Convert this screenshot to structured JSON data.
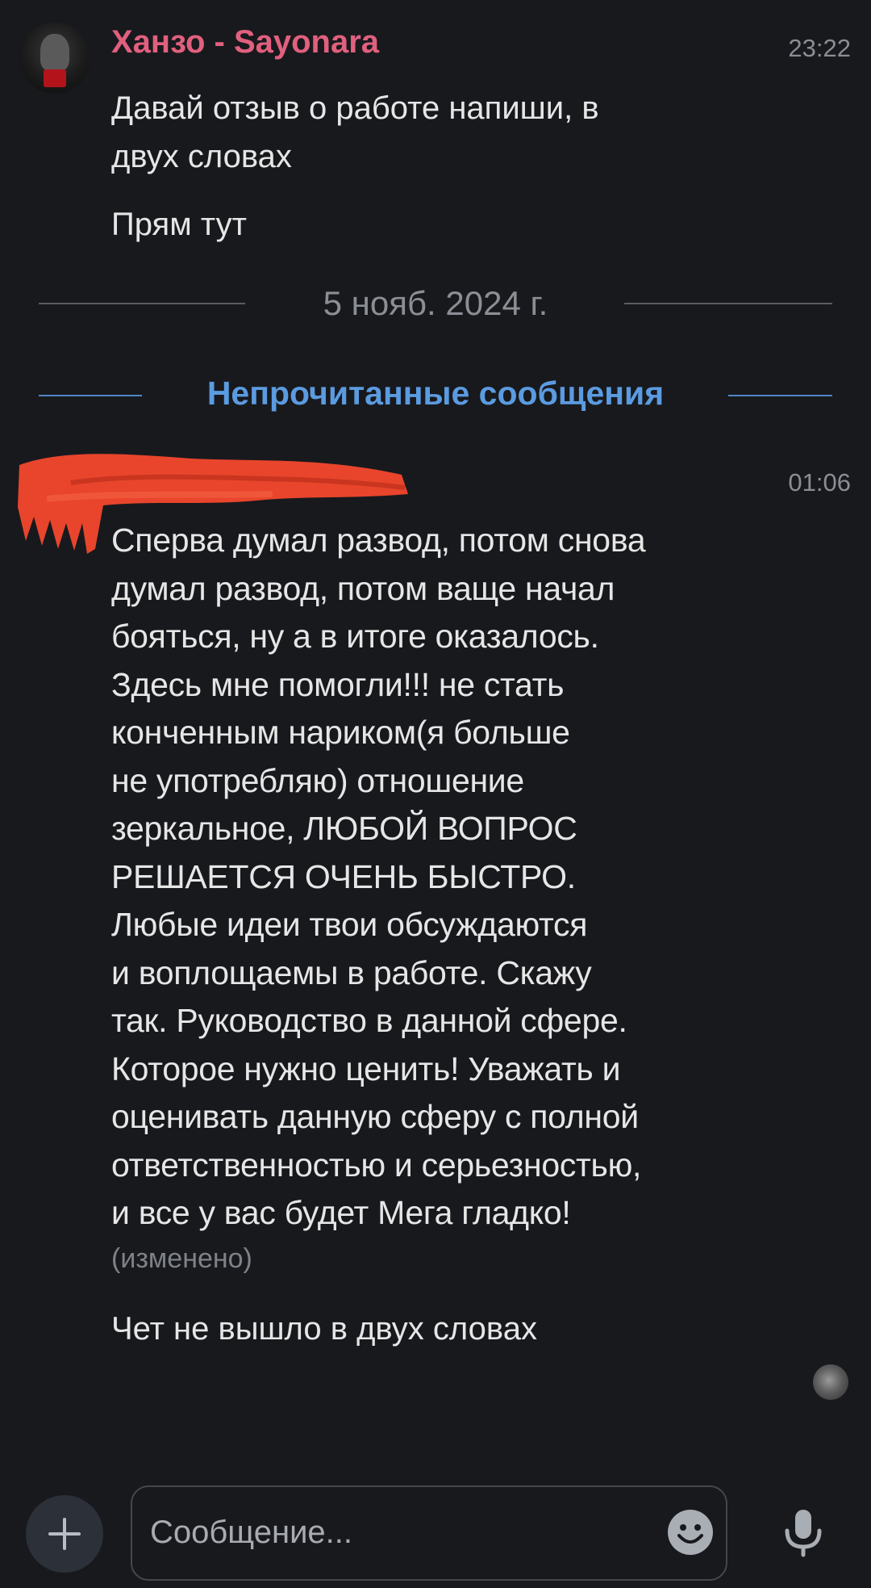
{
  "messages_group_1": {
    "sender": "Ханзо - Sayonara",
    "time": "23:22",
    "message_1": "Давай отзыв о работе напиши, в\nдвух словах",
    "message_2": "Прям тут"
  },
  "date_separator": "5 нояб. 2024 г.",
  "unread_separator": "Непрочитанные сообщения",
  "messages_group_2": {
    "time": "01:06",
    "message_1": "Сперва думал развод, потом снова\nдумал развод, потом ваще начал\nбояться, ну а в итоге оказалось.\nЗдесь мне помогли!!! не стать\nконченным нариком(я больше\nне употребляю) отношение\nзеркальное, ЛЮБОЙ ВОПРОС\nРЕШАЕТСЯ ОЧЕНЬ БЫСТРО.\nЛюбые идеи твои обсуждаются\nи воплощаемы в работе. Скажу\nтак. Руководство в данной сфере.\nКоторое нужно ценить! Уважать и\nоценивать данную сферу с полной\nответственностью и серьезностью,\nи все у вас будет Мега гладко!",
    "edited_label": "(изменено)",
    "message_2": "Чет не вышло в двух словах"
  },
  "composer": {
    "placeholder": "Сообщение..."
  },
  "icons": {
    "attach": "plus-icon",
    "emoji": "emoji-icon",
    "mic": "microphone-icon"
  },
  "colors": {
    "background": "#18191d",
    "sender_name": "#e0607e",
    "unread_accent": "#5b9be0",
    "redaction": "#e8452c"
  }
}
